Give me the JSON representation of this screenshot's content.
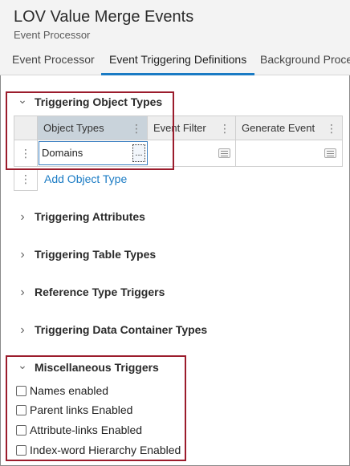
{
  "header": {
    "title": "LOV Value Merge Events",
    "subtitle": "Event Processor"
  },
  "tabs": [
    {
      "label": "Event Processor"
    },
    {
      "label": "Event Triggering Definitions",
      "active": true
    },
    {
      "label": "Background Proce"
    }
  ],
  "triggering_object_types": {
    "title": "Triggering Object Types",
    "columns": [
      "Object Types",
      "Event Filter",
      "Generate Event"
    ],
    "rows": [
      {
        "object_type": "Domains",
        "ellipsis": "...",
        "event_filter": "",
        "generate_event": ""
      }
    ],
    "add_label": "Add Object Type"
  },
  "sections": [
    {
      "title": "Triggering Attributes"
    },
    {
      "title": "Triggering Table Types"
    },
    {
      "title": "Reference Type Triggers"
    },
    {
      "title": "Triggering Data Container Types"
    }
  ],
  "misc": {
    "title": "Miscellaneous Triggers",
    "checkboxes": [
      {
        "label": "Names enabled",
        "checked": false
      },
      {
        "label": "Parent links Enabled",
        "checked": false
      },
      {
        "label": "Attribute-links Enabled",
        "checked": false
      },
      {
        "label": "Index-word Hierarchy Enabled",
        "checked": false
      }
    ]
  },
  "glyphs": {
    "chevron_down": "⌄",
    "chevron_right": "›",
    "kebab": "⋮"
  },
  "colors": {
    "accent": "#1a7bc4",
    "highlight": "#9b1c2c",
    "selected_header": "#c9d3db"
  }
}
